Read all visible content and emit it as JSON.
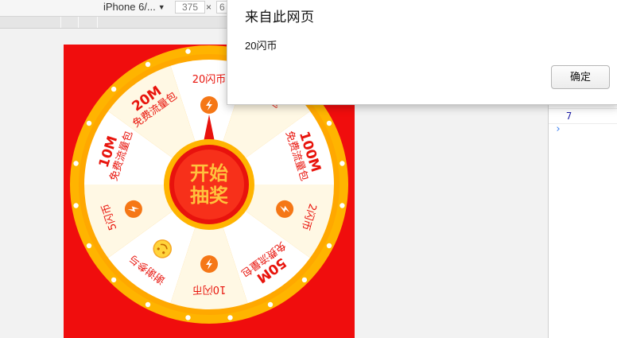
{
  "toolbar": {
    "device_name": "iPhone 6/...",
    "width_value": "375",
    "height_value": "6",
    "times_sign": "×"
  },
  "wheel": {
    "start_button_line1": "开始",
    "start_button_line2": "抽奖",
    "prizes": [
      {
        "amount": "",
        "label": "20闪币",
        "icon": "lightning-icon"
      },
      {
        "amount": "",
        "label": "量包",
        "icon": "none"
      },
      {
        "amount": "100M",
        "label": "免费流量包",
        "icon": "none"
      },
      {
        "amount": "",
        "label": "2闪币",
        "icon": "lightning-icon"
      },
      {
        "amount": "50M",
        "label": "免费流量包",
        "icon": "none"
      },
      {
        "amount": "",
        "label": "10闪币",
        "icon": "lightning-icon"
      },
      {
        "amount": "",
        "label": "谢谢参与",
        "icon": "smiley-icon"
      },
      {
        "amount": "",
        "label": "5闪币",
        "icon": "lightning-icon"
      },
      {
        "amount": "10M",
        "label": "免费流量包",
        "icon": "none"
      },
      {
        "amount": "20M",
        "label": "免费流量包",
        "icon": "none"
      }
    ],
    "colors": {
      "background": "#f00d0d",
      "rim": "#ffb400",
      "sector_light": "#fff8e4",
      "sector_white": "#ffffff",
      "text": "#e8140c",
      "icon": "#f57716"
    }
  },
  "console": {
    "log_value": "7",
    "prompt_symbol": "›"
  },
  "dialog": {
    "title": "来自此网页",
    "message": "20闪币",
    "ok_label": "确定"
  }
}
